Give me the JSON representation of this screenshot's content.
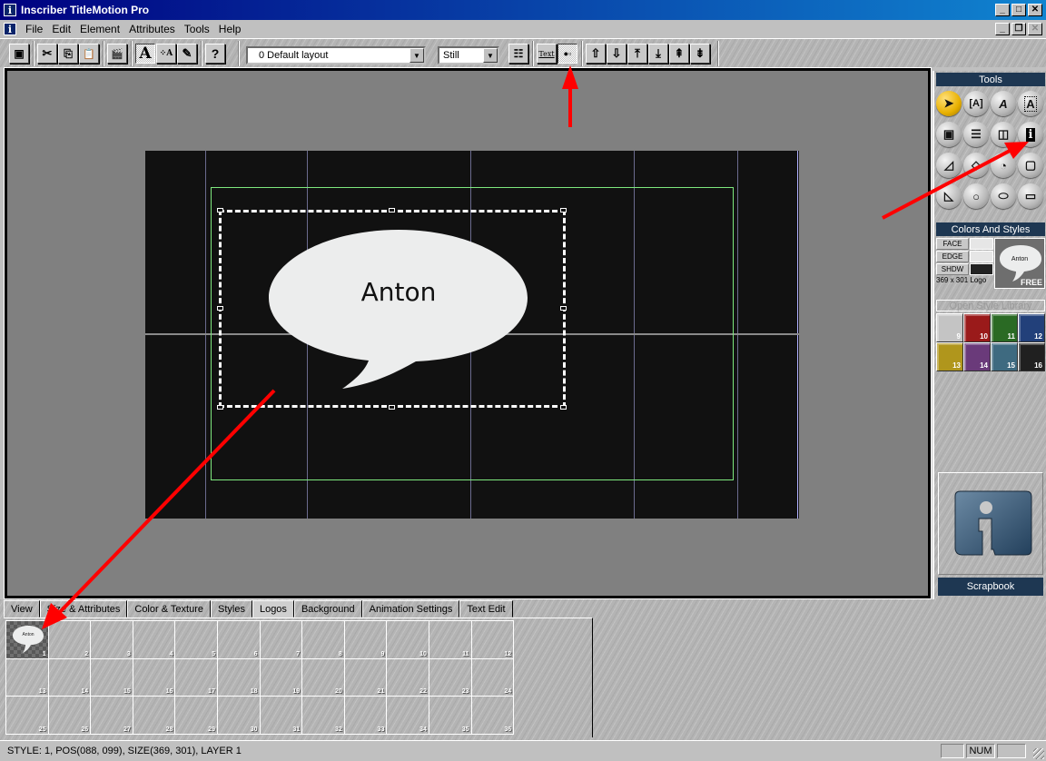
{
  "window": {
    "title": "Inscriber TitleMotion Pro",
    "app_icon": "i",
    "controls": [
      "minimize",
      "maximize",
      "close"
    ],
    "mdi_controls": [
      "minimize",
      "restore",
      "close"
    ]
  },
  "menu": {
    "items": [
      {
        "label": "File",
        "mnemonic": "F"
      },
      {
        "label": "Edit",
        "mnemonic": "E"
      },
      {
        "label": "Element",
        "mnemonic": "l"
      },
      {
        "label": "Attributes",
        "mnemonic": "A"
      },
      {
        "label": "Tools",
        "mnemonic": "T"
      },
      {
        "label": "Help",
        "mnemonic": "H"
      }
    ]
  },
  "toolbar": {
    "buttons": [
      {
        "name": "save",
        "icon": "floppy-disk-icon",
        "glyph": "💾"
      },
      {
        "name": "cut",
        "icon": "scissors-icon",
        "glyph": "✂"
      },
      {
        "name": "copy",
        "icon": "copy-icon",
        "glyph": "⎘"
      },
      {
        "name": "paste",
        "icon": "paste-icon",
        "glyph": "📋"
      },
      {
        "name": "clapper",
        "icon": "clapperboard-icon",
        "glyph": "🎬"
      },
      {
        "name": "text-tool",
        "icon": "text-a-icon",
        "glyph": "A",
        "pressed": true
      },
      {
        "name": "text-path",
        "icon": "text-path-icon",
        "glyph": "⁘A"
      },
      {
        "name": "brush",
        "icon": "brush-icon",
        "glyph": "✎"
      },
      {
        "name": "help",
        "icon": "question-icon",
        "glyph": "?"
      }
    ],
    "layout_select": {
      "value": "0 Default layout"
    },
    "mode_select": {
      "value": "Still"
    },
    "right_buttons": [
      {
        "name": "properties",
        "icon": "sliders-icon",
        "glyph": "☰"
      },
      {
        "name": "text-mode",
        "icon": "text-mode-icon",
        "glyph": "Text"
      },
      {
        "name": "shape-mode",
        "icon": "shape-mode-icon",
        "glyph": "●▫",
        "pressed": true
      },
      {
        "name": "bring-forward",
        "icon": "arrow-up-icon",
        "glyph": "⇧"
      },
      {
        "name": "send-backward",
        "icon": "arrow-down-icon",
        "glyph": "⇩"
      },
      {
        "name": "bring-to-front",
        "icon": "bring-front-icon",
        "glyph": "⤒"
      },
      {
        "name": "send-to-back",
        "icon": "send-back-icon",
        "glyph": "⤓"
      },
      {
        "name": "layer-up",
        "icon": "layer-up-icon",
        "glyph": "⇞"
      },
      {
        "name": "layer-down",
        "icon": "layer-down-icon",
        "glyph": "⇟"
      }
    ]
  },
  "canvas": {
    "element_text": "Anton",
    "colors": {
      "background": "#111111",
      "safe_area": "#7ee87e",
      "guide": "#6b6b8e",
      "bubble_fill": "#eceded"
    }
  },
  "tools_panel": {
    "title": "Tools",
    "tools": [
      {
        "name": "select",
        "icon": "arrow-pointer-icon",
        "glyph": "➤",
        "active": true
      },
      {
        "name": "text-box",
        "icon": "text-box-icon",
        "glyph": "[A]"
      },
      {
        "name": "text-on-path",
        "icon": "text-path-icon",
        "glyph": "A"
      },
      {
        "name": "text-frame",
        "icon": "text-frame-icon",
        "glyph": "A"
      },
      {
        "name": "safe-title",
        "icon": "frame-icon",
        "glyph": "▣"
      },
      {
        "name": "horizontal-bars",
        "icon": "bars-icon",
        "glyph": "☰"
      },
      {
        "name": "vertical-bars",
        "icon": "columns-icon",
        "glyph": "◫"
      },
      {
        "name": "logo",
        "icon": "info-logo-icon",
        "glyph": "i"
      },
      {
        "name": "triangle",
        "icon": "triangle-icon",
        "glyph": "◿"
      },
      {
        "name": "polygon",
        "icon": "polygon-icon",
        "glyph": "◇"
      },
      {
        "name": "pie",
        "icon": "pie-icon",
        "glyph": "◔"
      },
      {
        "name": "rectangle",
        "icon": "rectangle-icon",
        "glyph": "▢"
      },
      {
        "name": "quarter-shape",
        "icon": "quarter-shape-icon",
        "glyph": "◺"
      },
      {
        "name": "circle",
        "icon": "circle-icon",
        "glyph": "○"
      },
      {
        "name": "ellipse",
        "icon": "ellipse-icon",
        "glyph": "⬭"
      },
      {
        "name": "rounded-rect",
        "icon": "rounded-rect-icon",
        "glyph": "▭"
      }
    ]
  },
  "colors_styles": {
    "title": "Colors And Styles",
    "rows": [
      {
        "label": "FACE",
        "color": "#e6e6e6"
      },
      {
        "label": "EDGE",
        "color": "#e6e6e6"
      },
      {
        "label": "SHDW",
        "color": "#222222"
      }
    ],
    "size_label": "369 x 301 Logo",
    "preview_text": "Anton",
    "preview_badge": "FREE",
    "open_library_label": "Open Style Library",
    "swatches": [
      {
        "num": "9",
        "color": "#c4c4c4"
      },
      {
        "num": "10",
        "color": "#9a1a1a"
      },
      {
        "num": "11",
        "color": "#2a6a24"
      },
      {
        "num": "12",
        "color": "#22407a"
      },
      {
        "num": "13",
        "color": "#b0961c"
      },
      {
        "num": "14",
        "color": "#6a3a7a"
      },
      {
        "num": "15",
        "color": "#3e6a80"
      },
      {
        "num": "16",
        "color": "#202020"
      }
    ]
  },
  "scrapbook": {
    "label": "Scrapbook"
  },
  "bottom_tabs": [
    {
      "label": "View"
    },
    {
      "label": "Size & Attributes"
    },
    {
      "label": "Color & Texture"
    },
    {
      "label": "Styles"
    },
    {
      "label": "Logos",
      "active": true
    },
    {
      "label": "Background"
    },
    {
      "label": "Animation Settings"
    },
    {
      "label": "Text Edit"
    }
  ],
  "logo_slots": [
    {
      "num": "1",
      "content": "Anton"
    },
    {
      "num": "2"
    },
    {
      "num": "3"
    },
    {
      "num": "4"
    },
    {
      "num": "5"
    },
    {
      "num": "6"
    },
    {
      "num": "7"
    },
    {
      "num": "8"
    },
    {
      "num": "9"
    },
    {
      "num": "10"
    },
    {
      "num": "11"
    },
    {
      "num": "12"
    },
    {
      "num": "13"
    },
    {
      "num": "14"
    },
    {
      "num": "15"
    },
    {
      "num": "16"
    },
    {
      "num": "17"
    },
    {
      "num": "18"
    },
    {
      "num": "19"
    },
    {
      "num": "20"
    },
    {
      "num": "21"
    },
    {
      "num": "22"
    },
    {
      "num": "23"
    },
    {
      "num": "24"
    },
    {
      "num": "25"
    },
    {
      "num": "26"
    },
    {
      "num": "27"
    },
    {
      "num": "28"
    },
    {
      "num": "29"
    },
    {
      "num": "30"
    },
    {
      "num": "31"
    },
    {
      "num": "32"
    },
    {
      "num": "33"
    },
    {
      "num": "34"
    },
    {
      "num": "35"
    },
    {
      "num": "36"
    }
  ],
  "status": {
    "text": "STYLE: 1, POS(088, 099), SIZE(369, 301), LAYER 1",
    "indicators": [
      "",
      "NUM",
      ""
    ]
  }
}
